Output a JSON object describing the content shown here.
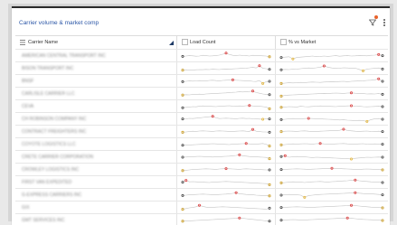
{
  "card": {
    "title": "Carrier volume & market comp"
  },
  "columns": {
    "carrier_name": "Carrier Name",
    "load_count": "Load Count",
    "pct_vs_market": "% vs Market",
    "sort_direction": "descending"
  },
  "colors": {
    "title": "#2a55a6",
    "sparkline": "#c4c4c4",
    "marker_start_end": "#444444",
    "marker_high": "#e03e3e",
    "marker_low": "#e8b83a",
    "badge": "#e8632b"
  },
  "icons": {
    "filter": "filter-icon",
    "menu": "more-vertical-icon",
    "column": "column-square-icon",
    "sort": "sort-descending-icon"
  },
  "rows": [
    {
      "carrier": "AMERICAN CENTRAL TRANSPORT INC",
      "load": [
        0.45,
        0.5,
        0.55,
        0.52,
        0.48,
        0.5,
        0.6,
        0.55,
        0.5,
        0.52,
        0.58,
        0.62,
        0.75,
        0.9,
        0.7,
        0.6,
        0.55,
        0.62,
        0.58,
        0.55,
        0.5,
        0.6,
        0.58,
        0.55,
        0.52,
        0.5,
        0.4
      ],
      "pct": [
        0.3,
        0.35,
        0.4,
        0.1,
        0.3,
        0.35,
        0.4,
        0.45,
        0.5,
        0.42,
        0.45,
        0.5,
        0.45,
        0.5,
        0.55,
        0.48,
        0.52,
        0.55,
        0.5,
        0.52,
        0.58,
        0.55,
        0.52,
        0.6,
        0.62,
        0.7,
        0.55
      ]
    },
    {
      "carrier": "BISON TRANSPORT INC",
      "load": [
        0.3,
        0.35,
        0.3,
        0.32,
        0.35,
        0.38,
        0.36,
        0.4,
        0.38,
        0.42,
        0.4,
        0.38,
        0.42,
        0.45,
        0.42,
        0.48,
        0.5,
        0.52,
        0.55,
        0.58,
        0.62,
        0.7,
        0.6,
        0.9,
        0.55,
        0.5,
        0.4
      ],
      "pct": [
        0.35,
        0.4,
        0.38,
        0.42,
        0.45,
        0.5,
        0.55,
        0.6,
        0.58,
        0.62,
        0.7,
        0.88,
        0.7,
        0.6,
        0.55,
        0.58,
        0.62,
        0.6,
        0.55,
        0.58,
        0.4,
        0.2,
        0.45,
        0.5,
        0.55,
        0.6,
        0.45
      ]
    },
    {
      "carrier": "BNSF",
      "load": [
        0.45,
        0.5,
        0.55,
        0.52,
        0.56,
        0.6,
        0.58,
        0.55,
        0.62,
        0.65,
        0.6,
        0.58,
        0.62,
        0.65,
        0.68,
        0.7,
        0.65,
        0.62,
        0.6,
        0.58,
        0.55,
        0.5,
        0.48,
        0.6,
        0.2,
        0.45,
        0.5
      ],
      "pct": [
        0.2,
        0.25,
        0.3,
        0.28,
        0.3,
        0.35,
        0.32,
        0.36,
        0.4,
        0.38,
        0.35,
        0.4,
        0.42,
        0.45,
        0.42,
        0.48,
        0.5,
        0.45,
        0.5,
        0.52,
        0.55,
        0.58,
        0.62,
        0.65,
        0.7,
        0.85,
        0.5
      ]
    },
    {
      "carrier": "CARLISLE CARRIER LLC",
      "load": [
        0.35,
        0.4,
        0.38,
        0.42,
        0.45,
        0.48,
        0.45,
        0.5,
        0.52,
        0.55,
        0.58,
        0.6,
        0.62,
        0.65,
        0.7,
        0.72,
        0.75,
        0.8,
        0.78,
        0.82,
        0.85,
        0.9,
        0.7,
        0.6,
        0.5,
        0.45,
        0.4
      ],
      "pct": [
        0.2,
        0.3,
        0.35,
        0.38,
        0.4,
        0.42,
        0.45,
        0.48,
        0.5,
        0.52,
        0.55,
        0.58,
        0.55,
        0.6,
        0.62,
        0.6,
        0.58,
        0.62,
        0.65,
        0.6,
        0.58,
        0.55,
        0.5,
        0.52,
        0.5,
        0.55,
        0.45
      ]
    },
    {
      "carrier": "CEVA",
      "load": [
        0.35,
        0.4,
        0.45,
        0.5,
        0.48,
        0.55,
        0.6,
        0.58,
        0.55,
        0.52,
        0.5,
        0.55,
        0.58,
        0.6,
        0.62,
        0.58,
        0.55,
        0.6,
        0.58,
        0.62,
        0.65,
        0.6,
        0.58,
        0.55,
        0.5,
        0.45,
        0.2
      ],
      "pct": [
        0.4,
        0.45,
        0.5,
        0.48,
        0.45,
        0.55,
        0.5,
        0.48,
        0.52,
        0.55,
        0.6,
        0.58,
        0.55,
        0.52,
        0.5,
        0.55,
        0.58,
        0.6,
        0.62,
        0.58,
        0.55,
        0.5,
        0.48,
        0.5,
        0.52,
        0.55,
        0.5
      ]
    },
    {
      "carrier": "CH ROBINSON COMPANY INC",
      "load": [
        0.55,
        0.58,
        0.62,
        0.6,
        0.65,
        0.7,
        0.75,
        0.8,
        0.85,
        0.9,
        0.7,
        0.6,
        0.62,
        0.65,
        0.62,
        0.6,
        0.58,
        0.62,
        0.65,
        0.6,
        0.62,
        0.58,
        0.55,
        0.52,
        0.5,
        0.55,
        0.55
      ],
      "pct": [
        0.45,
        0.5,
        0.55,
        0.6,
        0.58,
        0.55,
        0.6,
        0.62,
        0.6,
        0.58,
        0.55,
        0.52,
        0.5,
        0.48,
        0.45,
        0.4,
        0.42,
        0.38,
        0.35,
        0.3,
        0.35,
        0.32,
        0.2,
        0.45,
        0.55,
        0.6,
        0.5
      ]
    },
    {
      "carrier": "CONTRACT FREIGHTERS INC",
      "load": [
        0.45,
        0.5,
        0.55,
        0.6,
        0.58,
        0.62,
        0.65,
        0.62,
        0.6,
        0.58,
        0.62,
        0.65,
        0.62,
        0.6,
        0.58,
        0.55,
        0.6,
        0.62,
        0.65,
        0.6,
        0.58,
        0.85,
        0.6,
        0.55,
        0.5,
        0.5,
        0.45
      ],
      "pct": [
        0.55,
        0.6,
        0.62,
        0.6,
        0.58,
        0.62,
        0.65,
        0.6,
        0.58,
        0.55,
        0.6,
        0.62,
        0.65,
        0.68,
        0.7,
        0.72,
        0.88,
        0.7,
        0.65,
        0.6,
        0.58,
        0.6,
        0.62,
        0.58,
        0.55,
        0.6,
        0.55
      ]
    },
    {
      "carrier": "COYOTE LOGISTICS LLC",
      "load": [
        0.4,
        0.42,
        0.45,
        0.48,
        0.5,
        0.52,
        0.55,
        0.58,
        0.6,
        0.62,
        0.6,
        0.58,
        0.55,
        0.52,
        0.5,
        0.55,
        0.58,
        0.6,
        0.62,
        0.65,
        0.6,
        0.58,
        0.55,
        0.6,
        0.65,
        0.55,
        0.3
      ],
      "pct": [
        0.45,
        0.5,
        0.55,
        0.6,
        0.58,
        0.6,
        0.62,
        0.6,
        0.58,
        0.62,
        0.65,
        0.6,
        0.58,
        0.55,
        0.6,
        0.62,
        0.65,
        0.6,
        0.58,
        0.55,
        0.6,
        0.62,
        0.58,
        0.55,
        0.6,
        0.58,
        0.55
      ]
    },
    {
      "carrier": "CRETE CARRIER CORPORATION",
      "load": [
        0.5,
        0.52,
        0.55,
        0.58,
        0.6,
        0.62,
        0.6,
        0.58,
        0.55,
        0.52,
        0.55,
        0.58,
        0.6,
        0.62,
        0.65,
        0.7,
        0.75,
        0.82,
        0.7,
        0.65,
        0.6,
        0.58,
        0.55,
        0.52,
        0.5,
        0.48,
        0.3
      ],
      "pct": [
        0.6,
        0.7,
        0.5,
        0.55,
        0.6,
        0.58,
        0.55,
        0.5,
        0.45,
        0.5,
        0.48,
        0.45,
        0.42,
        0.4,
        0.38,
        0.35,
        0.32,
        0.3,
        0.25,
        0.35,
        0.4,
        0.45,
        0.5,
        0.48,
        0.5,
        0.52,
        0.5
      ]
    },
    {
      "carrier": "CROWLEY LOGISTICS INC",
      "load": [
        0.4,
        0.45,
        0.5,
        0.55,
        0.58,
        0.6,
        0.62,
        0.65,
        0.62,
        0.6,
        0.58,
        0.62,
        0.65,
        0.68,
        0.65,
        0.62,
        0.6,
        0.58,
        0.62,
        0.65,
        0.62,
        0.6,
        0.58,
        0.55,
        0.52,
        0.5,
        0.5
      ],
      "pct": [
        0.55,
        0.58,
        0.6,
        0.62,
        0.65,
        0.62,
        0.6,
        0.58,
        0.6,
        0.62,
        0.65,
        0.68,
        0.7,
        0.72,
        0.7,
        0.68,
        0.65,
        0.62,
        0.6,
        0.58,
        0.55,
        0.6,
        0.62,
        0.6,
        0.58,
        0.55,
        0.5
      ]
    },
    {
      "carrier": "FIRST VAN EXPEDITED",
      "load": [
        0.55,
        0.8,
        0.6,
        0.62,
        0.6,
        0.58,
        0.55,
        0.52,
        0.5,
        0.55,
        0.58,
        0.6,
        0.62,
        0.65,
        0.62,
        0.6,
        0.58,
        0.55,
        0.52,
        0.5,
        0.48,
        0.45,
        0.42,
        0.4,
        0.38,
        0.35,
        0.2
      ],
      "pct": [
        0.45,
        0.5,
        0.55,
        0.6,
        0.58,
        0.55,
        0.5,
        0.55,
        0.6,
        0.62,
        0.65,
        0.6,
        0.58,
        0.62,
        0.65,
        0.7,
        0.72,
        0.75,
        0.8,
        0.85,
        0.75,
        0.7,
        0.65,
        0.6,
        0.58,
        0.55,
        0.5
      ]
    },
    {
      "carrier": "G-EXPRESS CARRIERS INC",
      "load": [
        0.45,
        0.5,
        0.55,
        0.58,
        0.6,
        0.62,
        0.65,
        0.62,
        0.6,
        0.58,
        0.55,
        0.6,
        0.62,
        0.65,
        0.7,
        0.75,
        0.85,
        0.7,
        0.65,
        0.6,
        0.58,
        0.55,
        0.5,
        0.48,
        0.45,
        0.42,
        0.4
      ],
      "pct": [
        0.5,
        0.55,
        0.6,
        0.58,
        0.55,
        0.5,
        0.2,
        0.45,
        0.5,
        0.55,
        0.6,
        0.62,
        0.65,
        0.68,
        0.7,
        0.72,
        0.75,
        0.78,
        0.8,
        0.85,
        0.78,
        0.72,
        0.7,
        0.68,
        0.65,
        0.6,
        0.55
      ]
    },
    {
      "carrier": "GIX",
      "load": [
        0.3,
        0.4,
        0.5,
        0.55,
        0.65,
        0.85,
        0.7,
        0.6,
        0.55,
        0.58,
        0.6,
        0.62,
        0.65,
        0.62,
        0.6,
        0.58,
        0.55,
        0.52,
        0.5,
        0.48,
        0.45,
        0.42,
        0.4,
        0.38,
        0.35,
        0.3,
        0.45
      ],
      "pct": [
        0.55,
        0.58,
        0.6,
        0.62,
        0.65,
        0.62,
        0.6,
        0.58,
        0.55,
        0.6,
        0.62,
        0.65,
        0.68,
        0.7,
        0.72,
        0.75,
        0.78,
        0.8,
        0.85,
        0.8,
        0.75,
        0.7,
        0.65,
        0.6,
        0.58,
        0.55,
        0.5
      ]
    },
    {
      "carrier": "GMT SERVICES INC",
      "load": [
        0.4,
        0.42,
        0.45,
        0.48,
        0.5,
        0.52,
        0.55,
        0.58,
        0.6,
        0.62,
        0.65,
        0.68,
        0.7,
        0.72,
        0.75,
        0.78,
        0.8,
        0.85,
        0.8,
        0.75,
        0.7,
        0.65,
        0.6,
        0.55,
        0.5,
        0.45,
        0.4
      ],
      "pct": [
        0.55,
        0.58,
        0.6,
        0.62,
        0.6,
        0.58,
        0.55,
        0.6,
        0.62,
        0.65,
        0.68,
        0.7,
        0.72,
        0.75,
        0.78,
        0.8,
        0.82,
        0.85,
        0.8,
        0.75,
        0.7,
        0.65,
        0.62,
        0.6,
        0.58,
        0.55,
        0.5
      ]
    }
  ]
}
